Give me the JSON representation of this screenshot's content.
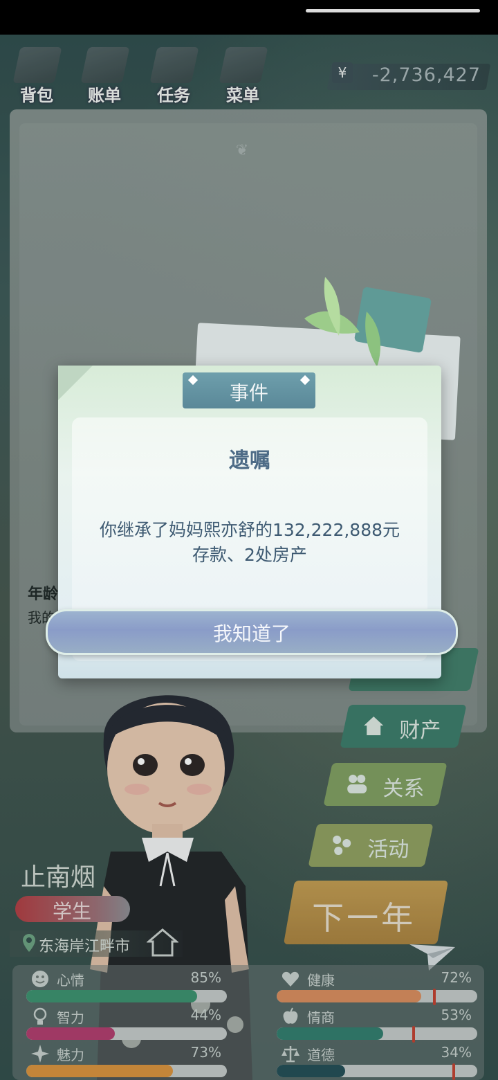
{
  "nav": {
    "bag": "背包",
    "bill": "账单",
    "tasks": "任务",
    "menu": "菜单"
  },
  "money": {
    "currency_symbol": "¥",
    "amount": "-2,736,427"
  },
  "log": {
    "age_label": "年龄",
    "line_start": "我的"
  },
  "side_buttons": {
    "property": "财产",
    "relations": "关系",
    "activities": "活动",
    "next_year": "下一年"
  },
  "character": {
    "name": "止南烟",
    "role": "学生",
    "location": "东海岸江畔市"
  },
  "stats": [
    {
      "name": "心情",
      "value": "85%",
      "fraction": 0.85,
      "color": "#3a8f6b",
      "icon": "smiley-icon"
    },
    {
      "name": "健康",
      "value": "72%",
      "fraction": 0.72,
      "color": "#d98a5a",
      "icon": "heart-icon"
    },
    {
      "name": "智力",
      "value": "44%",
      "fraction": 0.44,
      "color": "#b03a6a",
      "icon": "lightbulb-icon"
    },
    {
      "name": "情商",
      "value": "53%",
      "fraction": 0.53,
      "color": "#2f7a6a",
      "icon": "apple-icon"
    },
    {
      "name": "魅力",
      "value": "73%",
      "fraction": 0.73,
      "color": "#d9903a",
      "icon": "sparkle-icon"
    },
    {
      "name": "道德",
      "value": "34%",
      "fraction": 0.34,
      "color": "#204a52",
      "icon": "scales-icon"
    }
  ],
  "dialog": {
    "tab_title": "事件",
    "event_title": "遗嘱",
    "text_line1": "你继承了妈妈熙亦舒的132,222,888元",
    "text_line2": "存款、2处房产",
    "ok_label": "我知道了"
  }
}
